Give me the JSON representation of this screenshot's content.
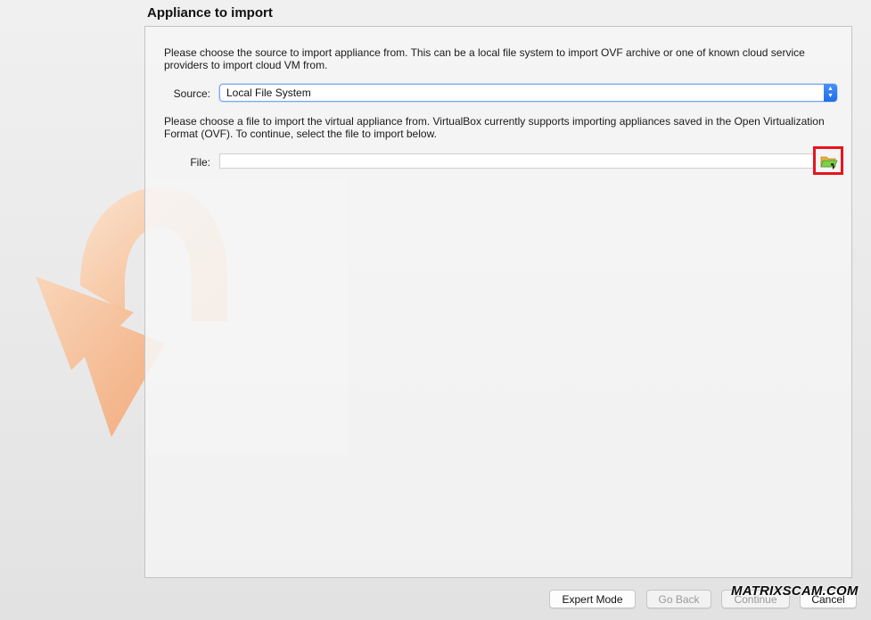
{
  "page": {
    "title": "Appliance to import"
  },
  "content": {
    "source_description": "Please choose the source to import appliance from. This can be a local file system to import OVF archive or one of known cloud service providers to import cloud VM from.",
    "source_label": "Source:",
    "source_value": "Local File System",
    "file_description": "Please choose a file to import the virtual appliance from. VirtualBox currently supports importing appliances saved in the Open Virtualization Format (OVF). To continue, select the file to import below.",
    "file_label": "File:",
    "file_value": "",
    "file_browse_icon": "folder-open-icon"
  },
  "buttons": {
    "expert_mode": "Expert Mode",
    "go_back": "Go Back",
    "continue": "Continue",
    "cancel": "Cancel"
  },
  "watermark": "MATRIXSCAM.COM",
  "colors": {
    "highlight": "#e8141c",
    "select_accent": "#1e6fe6"
  }
}
